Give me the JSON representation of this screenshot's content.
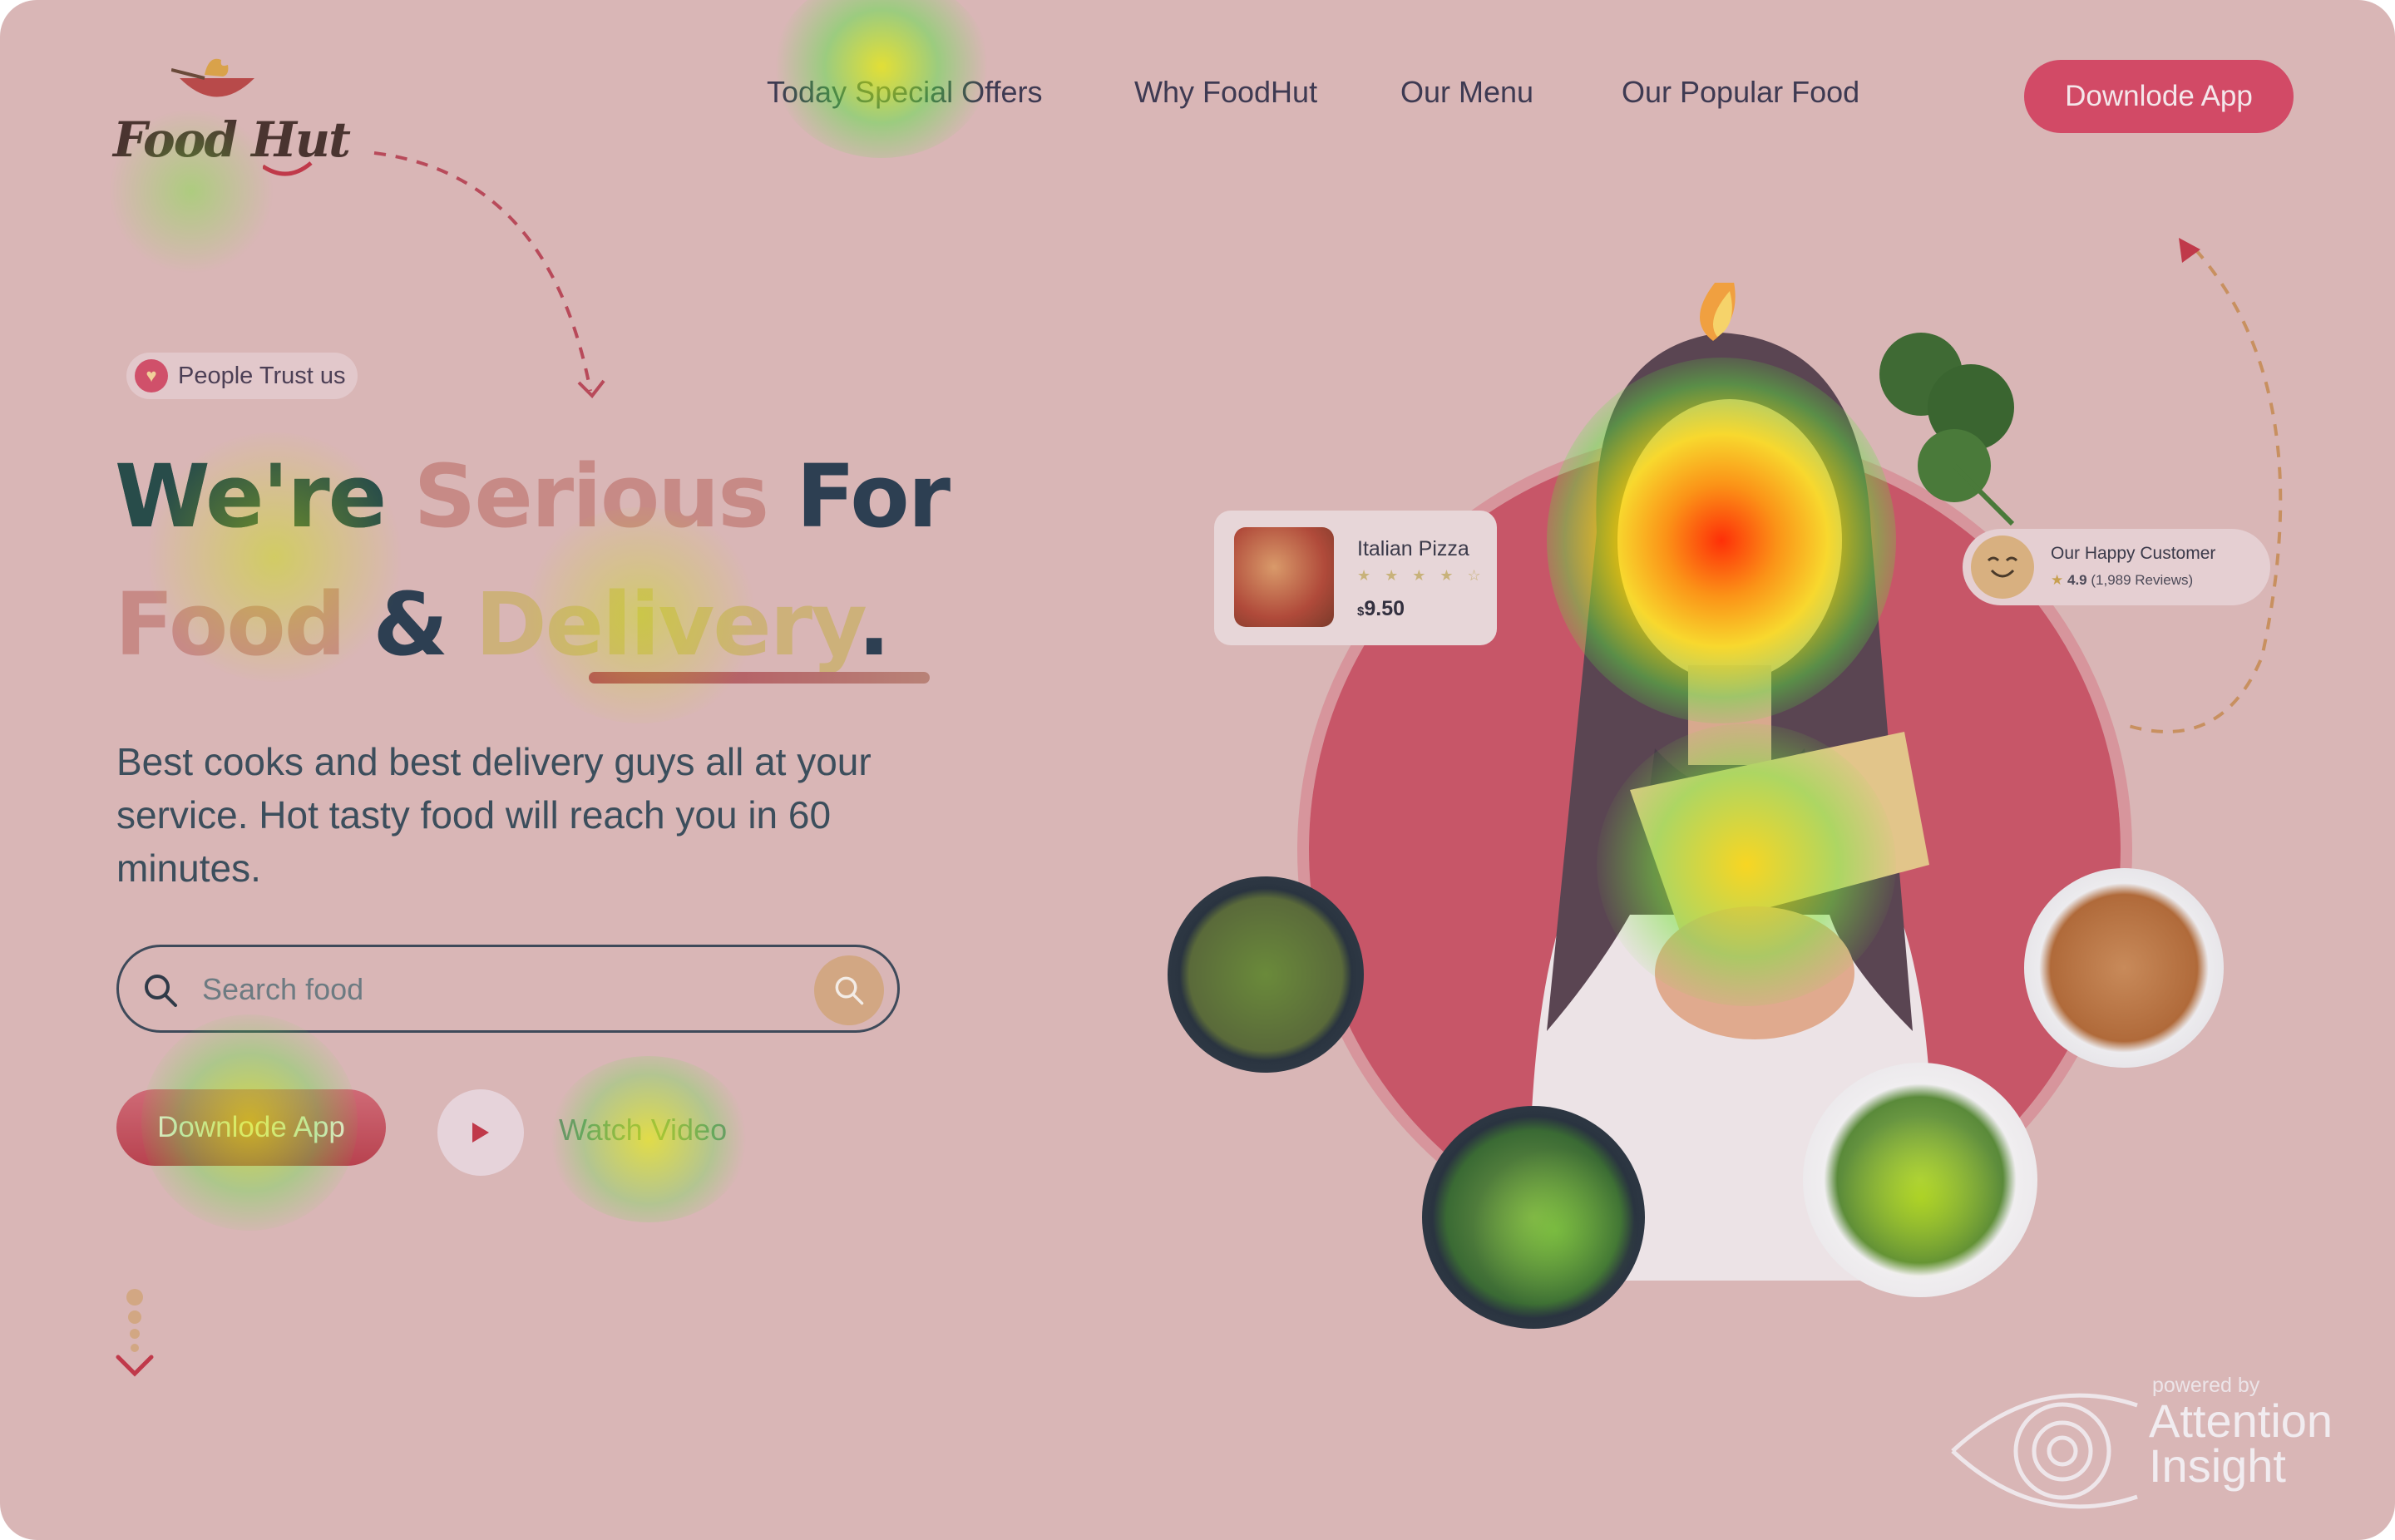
{
  "brand": {
    "logo_text": "Food Hut"
  },
  "nav": {
    "items": [
      {
        "label": "Today Special Offers"
      },
      {
        "label": "Why FoodHut"
      },
      {
        "label": "Our Menu"
      },
      {
        "label": "Our Popular Food"
      }
    ],
    "cta_label": "Downlode App"
  },
  "hero": {
    "badge": "People Trust us",
    "headline": {
      "line1": [
        "We're",
        "Serious",
        "For"
      ],
      "line2": [
        "Food",
        "&",
        "Delivery",
        "."
      ]
    },
    "subtitle": "Best cooks and best delivery guys all at your service. Hot tasty food will reach you in 60 minutes.",
    "search": {
      "placeholder": "Search food",
      "value": ""
    },
    "cta_label": "Downlode App",
    "video_label": "Watch Video"
  },
  "cards": {
    "pizza": {
      "name": "Italian Pizza",
      "stars": "★ ★ ★ ★ ☆",
      "currency": "$",
      "price": "9.50"
    },
    "customer": {
      "title": "Our Happy Customer",
      "rating": "4.9",
      "reviews": "(1,989 Reviews)"
    }
  },
  "watermark": {
    "powered": "powered by",
    "brand_line1": "Attention",
    "brand_line2": "Insight"
  },
  "colors": {
    "accent": "#d24a66",
    "gold": "#d2a783",
    "overlay_tint": "#d9b6b6",
    "heat_hot": "#ff2a00",
    "heat_mid": "#ffe600",
    "heat_low": "#39ff3a"
  }
}
